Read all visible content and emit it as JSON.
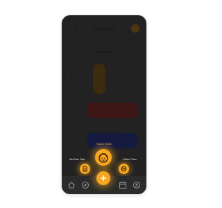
{
  "header": {
    "title": "SCHEDULE"
  },
  "calendar": {
    "month": "September"
  },
  "fab_menu": {
    "switch_profile_label": "Switch Profile",
    "add_new_task_label": "Add New Task",
    "online_class_label": "Online Class"
  },
  "colors": {
    "accent": "#f5a623",
    "overlay": "#222222",
    "nav_bar": "#2b2b2b"
  },
  "icons": {
    "back": "arrow-left-icon",
    "switch_profile": "face-icon",
    "add_new_task": "document-icon",
    "online_class": "toggle-icon",
    "nav": [
      "home-icon",
      "compass-icon",
      "plus-icon",
      "calendar-icon",
      "user-icon"
    ]
  }
}
